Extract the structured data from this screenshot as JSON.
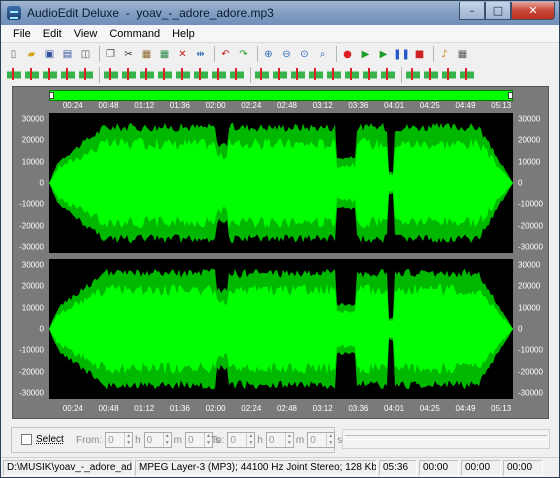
{
  "window": {
    "app_name": "AudioEdit Deluxe",
    "separator": "-",
    "file_name": "yoav_-_adore_adore.mp3"
  },
  "window_controls": {
    "minimize": "–",
    "maximize": "□",
    "close": "✕"
  },
  "menu": [
    "File",
    "Edit",
    "View",
    "Command",
    "Help"
  ],
  "toolbar1_icons": [
    "new-file-icon",
    "open-folder-icon",
    "save-icon",
    "save-as-icon",
    "properties-icon",
    "copy-icon",
    "cut-icon",
    "paste-icon",
    "mix-paste-icon",
    "delete-icon",
    "trim-icon",
    "undo-icon",
    "redo-icon",
    "zoom-in-icon",
    "zoom-out-icon",
    "zoom-selection-icon",
    "zoom-all-icon",
    "record-icon",
    "play-icon",
    "play-selection-icon",
    "pause-icon",
    "stop-icon",
    "sound-settings-icon",
    "options-icon"
  ],
  "toolbar2_icons": [
    "amplify-icon",
    "normalize-icon",
    "fade-in-icon",
    "fade-out-icon",
    "silence-icon",
    "echo-icon",
    "reverb-icon",
    "chorus-icon",
    "flanger-icon",
    "vibrato-icon",
    "tremolo-icon",
    "pitch-icon",
    "tempo-icon",
    "reverse-icon",
    "invert-icon",
    "compressor-icon",
    "noise-gate-icon",
    "equalizer-icon",
    "band-pass-icon",
    "low-pass-icon",
    "high-pass-icon",
    "noise-reduction-icon",
    "stereo-icon",
    "mono-icon",
    "dc-offset-icon"
  ],
  "timeline": {
    "ticks": [
      "00:24",
      "00:48",
      "01:12",
      "01:36",
      "02:00",
      "02:24",
      "02:48",
      "03:12",
      "03:36",
      "04:01",
      "04:25",
      "04:49",
      "05:13"
    ]
  },
  "amplitude_axis": [
    "30000",
    "20000",
    "10000",
    "0",
    "-10000",
    "-20000",
    "-30000"
  ],
  "colors": {
    "waveform": "#00ff00",
    "background": "#000000",
    "frame": "#7a7a7a"
  },
  "selection": {
    "checkbox_label": "Select",
    "from_label": "From:",
    "to_label": "To:",
    "from": {
      "h": "0",
      "m": "0",
      "s": "0"
    },
    "to": {
      "h": "0",
      "m": "0",
      "s": "0"
    },
    "unit_h": "h",
    "unit_m": "m",
    "unit_s": "s"
  },
  "status": {
    "path": "D:\\MUSIK\\yoav_-_adore_adore",
    "format": "MPEG Layer-3 (MP3); 44100 Hz Joint Stereo; 128 Kbps",
    "duration": "05:36",
    "sel_start": "00:00",
    "sel_end": "00:00",
    "sel_length": "00:00"
  }
}
